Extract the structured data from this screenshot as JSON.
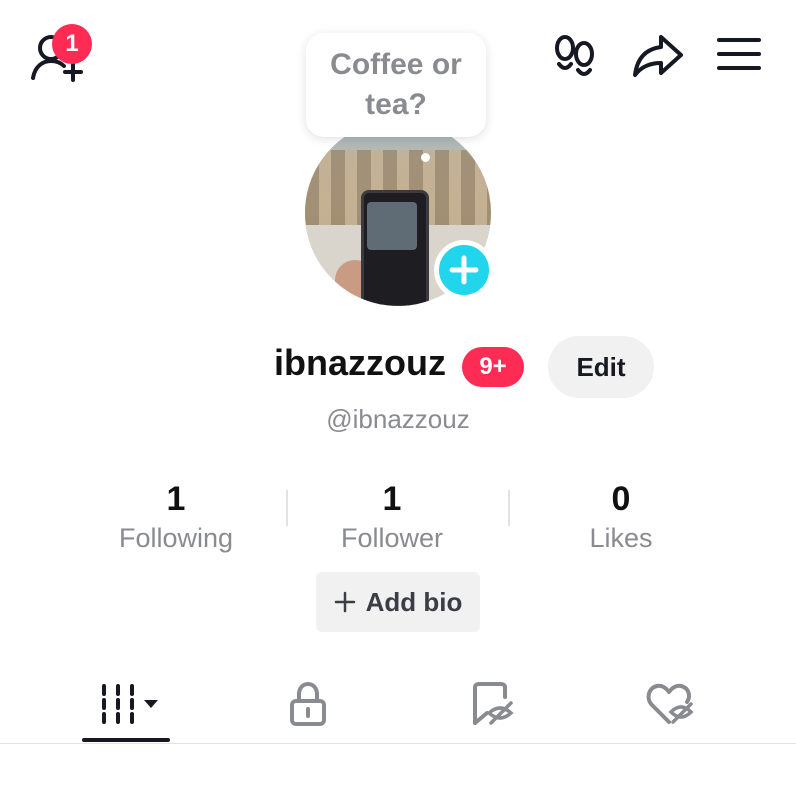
{
  "topbar": {
    "add_friends_icon": "person-plus-icon",
    "notification_count": "1",
    "footprint_icon": "footprints-icon",
    "share_icon": "share-arrow-icon",
    "menu_icon": "hamburger-menu-icon"
  },
  "profile": {
    "note_bubble": "Coffee or tea?",
    "username": "ibnazzouz",
    "username_badge": "9+",
    "edit_label": "Edit",
    "handle": "@ibnazzouz",
    "add_bio_label": "Add bio"
  },
  "stats": [
    {
      "value": "1",
      "label": "Following"
    },
    {
      "value": "1",
      "label": "Follower"
    },
    {
      "value": "0",
      "label": "Likes"
    }
  ],
  "tabs": [
    {
      "icon": "videos-grid-icon",
      "selected": true
    },
    {
      "icon": "lock-icon",
      "selected": false
    },
    {
      "icon": "bookmark-hidden-icon",
      "selected": false
    },
    {
      "icon": "heart-hidden-icon",
      "selected": false
    }
  ],
  "colors": {
    "accent_red": "#fe2c55",
    "accent_cyan": "#20d5ec",
    "secondary_text": "#8a8b91"
  }
}
